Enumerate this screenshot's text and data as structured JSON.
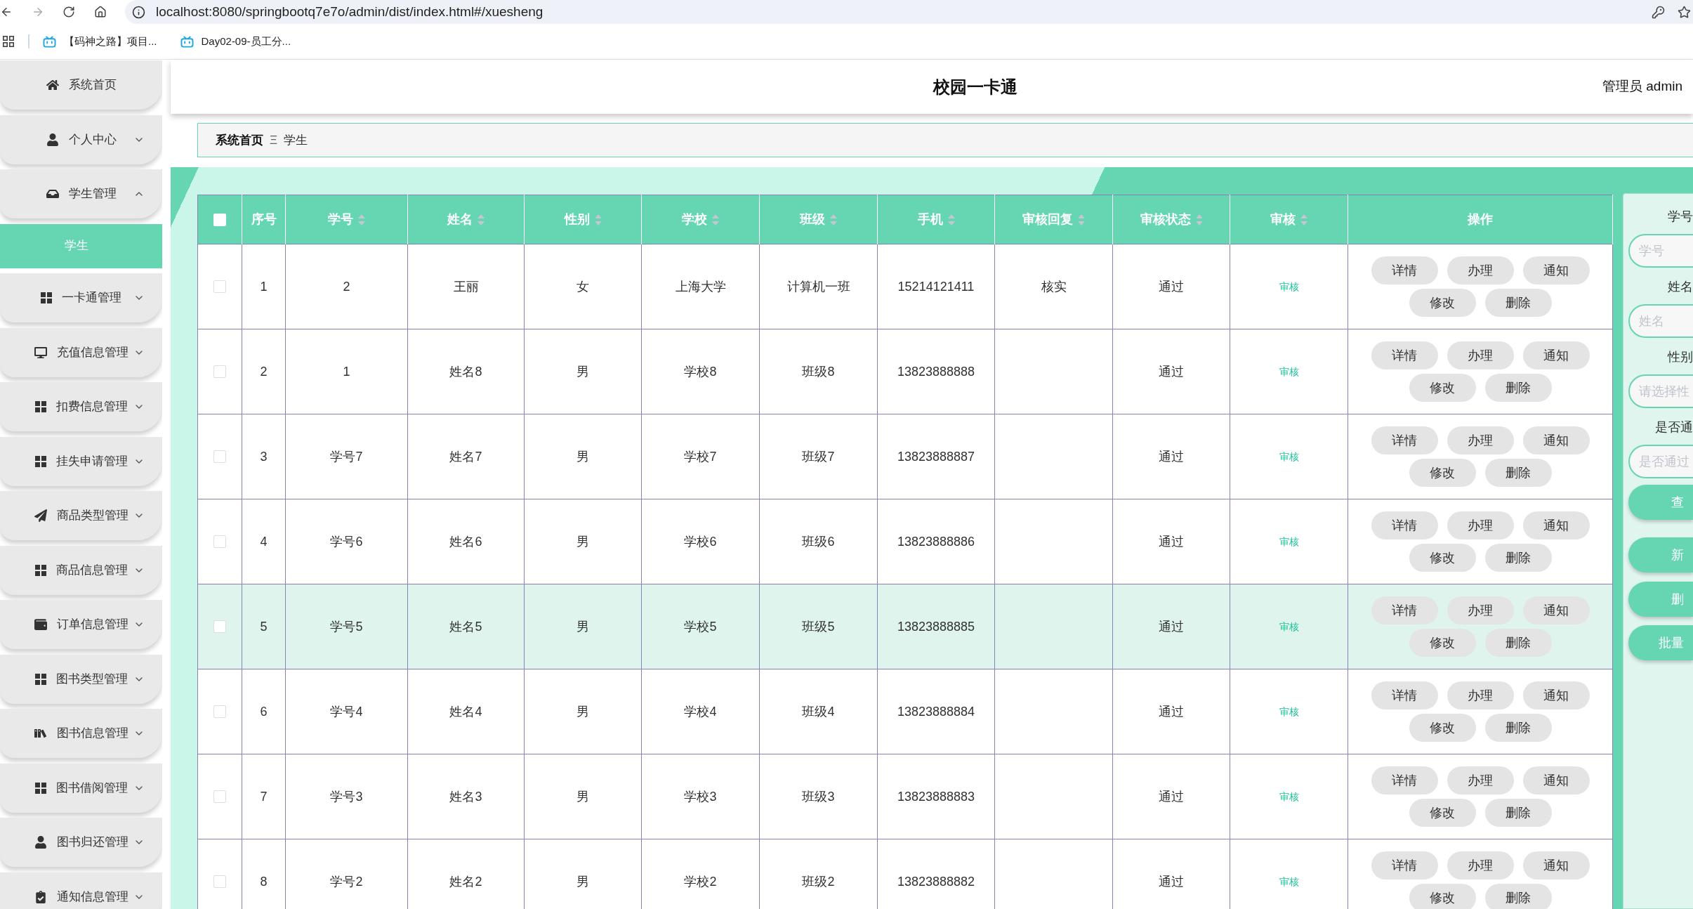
{
  "browser": {
    "url": "localhost:8080/springbootq7e7o/admin/dist/index.html#/xuesheng",
    "bookmarks": [
      {
        "label": "【码神之路】项目..."
      },
      {
        "label": "Day02-09-员工分..."
      }
    ]
  },
  "sidebar": {
    "items": [
      {
        "label": "系统首页",
        "selected": false
      },
      {
        "label": "个人中心",
        "selected": false,
        "expanded": false
      },
      {
        "label": "学生管理",
        "selected": false,
        "expanded": true,
        "children": [
          {
            "label": "学生",
            "selected": true
          }
        ]
      },
      {
        "label": "一卡通管理",
        "selected": false,
        "expanded": false
      },
      {
        "label": "充值信息管理",
        "selected": false,
        "expanded": false
      },
      {
        "label": "扣费信息管理",
        "selected": false,
        "expanded": false
      },
      {
        "label": "挂失申请管理",
        "selected": false,
        "expanded": false
      },
      {
        "label": "商品类型管理",
        "selected": false,
        "expanded": false
      },
      {
        "label": "商品信息管理",
        "selected": false,
        "expanded": false
      },
      {
        "label": "订单信息管理",
        "selected": false,
        "expanded": false
      },
      {
        "label": "图书类型管理",
        "selected": false,
        "expanded": false
      },
      {
        "label": "图书信息管理",
        "selected": false,
        "expanded": false
      },
      {
        "label": "图书借阅管理",
        "selected": false,
        "expanded": false
      },
      {
        "label": "图书归还管理",
        "selected": false,
        "expanded": false
      },
      {
        "label": "通知信息管理",
        "selected": false,
        "expanded": false
      }
    ]
  },
  "header": {
    "title": "校园一卡通",
    "user": "管理员 admin"
  },
  "breadcrumb": {
    "items": [
      {
        "label": "系统首页"
      },
      {
        "label": "学生"
      }
    ],
    "separator": "Ξ"
  },
  "table": {
    "select_all": {
      "checked": false
    },
    "columns": [
      {
        "label": "序号",
        "sortable": false
      },
      {
        "label": "学号",
        "sortable": true
      },
      {
        "label": "姓名",
        "sortable": true
      },
      {
        "label": "性别",
        "sortable": true
      },
      {
        "label": "学校",
        "sortable": true
      },
      {
        "label": "班级",
        "sortable": true
      },
      {
        "label": "手机",
        "sortable": true
      },
      {
        "label": "审核回复",
        "sortable": true
      },
      {
        "label": "审核状态",
        "sortable": true
      },
      {
        "label": "审核",
        "sortable": true
      },
      {
        "label": "操作",
        "sortable": false
      }
    ],
    "rows": [
      {
        "checked": false,
        "highlighted": false,
        "index": "1",
        "student_no": "2",
        "name": "王丽",
        "gender": "女",
        "school": "上海大学",
        "class": "计算机一班",
        "phone": "15214121411",
        "audit_reply": "核实",
        "audit_status": "通过",
        "audit_link": "审核",
        "actions": [
          "详情",
          "办理",
          "通知",
          "修改",
          "删除"
        ]
      },
      {
        "checked": false,
        "highlighted": false,
        "index": "2",
        "student_no": "1",
        "name": "姓名8",
        "gender": "男",
        "school": "学校8",
        "class": "班级8",
        "phone": "13823888888",
        "audit_status": "通过",
        "audit_link": "审核",
        "actions": [
          "详情",
          "办理",
          "通知",
          "修改",
          "删除"
        ]
      },
      {
        "checked": false,
        "highlighted": false,
        "index": "3",
        "student_no": "学号7",
        "name": "姓名7",
        "gender": "男",
        "school": "学校7",
        "class": "班级7",
        "phone": "13823888887",
        "audit_status": "通过",
        "audit_link": "审核",
        "actions": [
          "详情",
          "办理",
          "通知",
          "修改",
          "删除"
        ]
      },
      {
        "checked": false,
        "highlighted": false,
        "index": "4",
        "student_no": "学号6",
        "name": "姓名6",
        "gender": "男",
        "school": "学校6",
        "class": "班级6",
        "phone": "13823888886",
        "audit_status": "通过",
        "audit_link": "审核",
        "actions": [
          "详情",
          "办理",
          "通知",
          "修改",
          "删除"
        ]
      },
      {
        "checked": false,
        "highlighted": true,
        "index": "5",
        "student_no": "学号5",
        "name": "姓名5",
        "gender": "男",
        "school": "学校5",
        "class": "班级5",
        "phone": "13823888885",
        "audit_status": "通过",
        "audit_link": "审核",
        "actions": [
          "详情",
          "办理",
          "通知",
          "修改",
          "删除"
        ]
      },
      {
        "checked": false,
        "highlighted": false,
        "index": "6",
        "student_no": "学号4",
        "name": "姓名4",
        "gender": "男",
        "school": "学校4",
        "class": "班级4",
        "phone": "13823888884",
        "audit_status": "通过",
        "audit_link": "审核",
        "actions": [
          "详情",
          "办理",
          "通知",
          "修改",
          "删除"
        ]
      },
      {
        "checked": false,
        "highlighted": false,
        "index": "7",
        "student_no": "学号3",
        "name": "姓名3",
        "gender": "男",
        "school": "学校3",
        "class": "班级3",
        "phone": "13823888883",
        "audit_status": "通过",
        "audit_link": "审核",
        "actions": [
          "详情",
          "办理",
          "通知",
          "修改",
          "删除"
        ]
      },
      {
        "checked": false,
        "highlighted": false,
        "index": "8",
        "student_no": "学号2",
        "name": "姓名2",
        "gender": "男",
        "school": "学校2",
        "class": "班级2",
        "phone": "13823888882",
        "audit_status": "通过",
        "audit_link": "审核",
        "actions": [
          "详情",
          "办理",
          "通知",
          "修改",
          "删除"
        ]
      }
    ]
  },
  "search": {
    "fields": [
      {
        "label": "学号",
        "placeholder": "学号"
      },
      {
        "label": "姓名",
        "placeholder": "姓名"
      },
      {
        "label": "性别",
        "placeholder": "请选择性"
      },
      {
        "label": "是否通",
        "placeholder": "是否通过"
      }
    ],
    "buttons": [
      "查",
      "新",
      "删",
      "批量"
    ]
  }
}
